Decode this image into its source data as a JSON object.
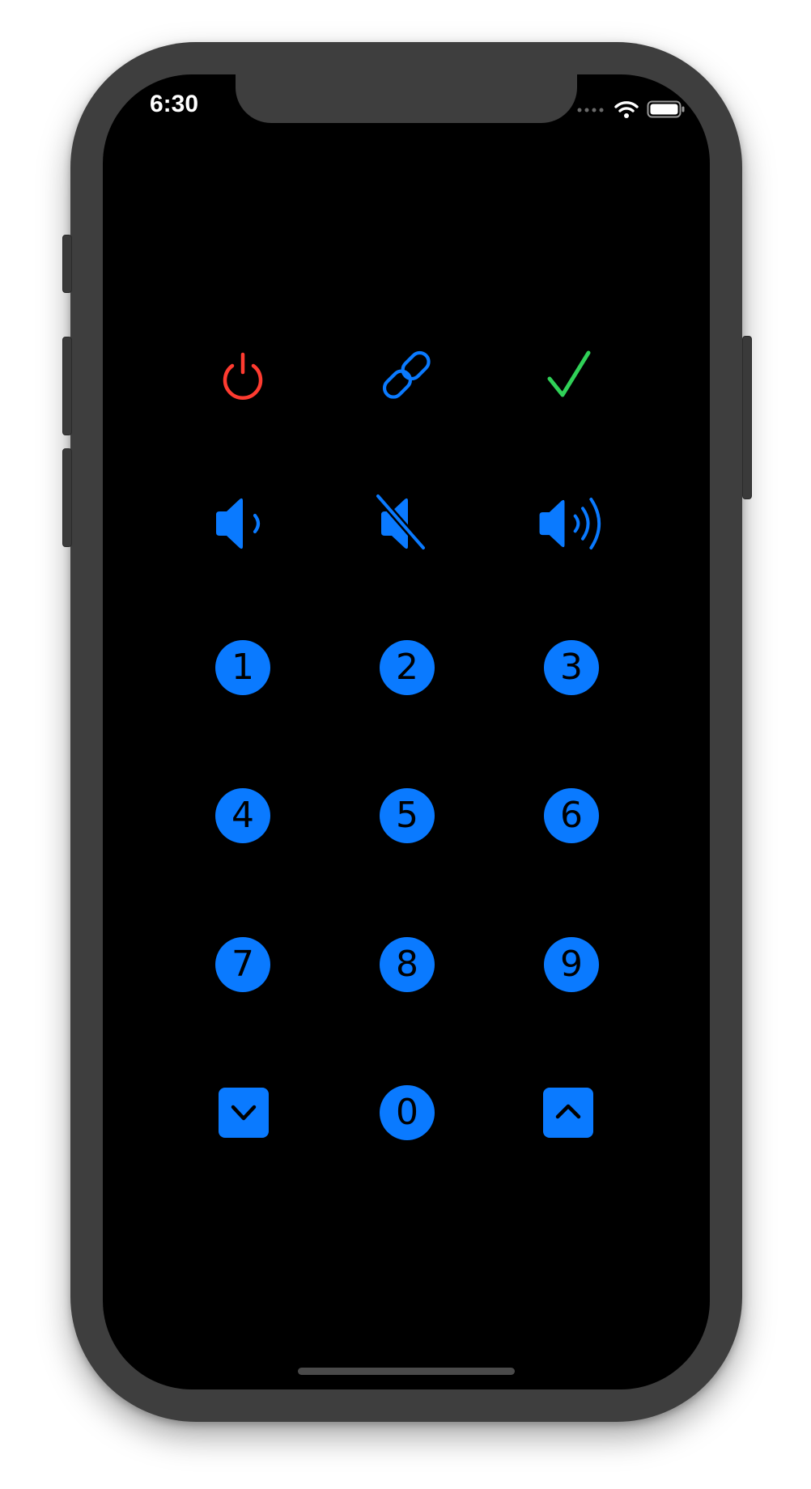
{
  "status_bar": {
    "time": "6:30",
    "icons": [
      "signal-dots-icon",
      "wifi-icon",
      "battery-icon"
    ]
  },
  "colors": {
    "accent": "#0a7aff",
    "power": "#ff3b30",
    "check": "#30d158",
    "background": "#000000",
    "device_frame": "#3e3e3e"
  },
  "controls": {
    "row1": [
      "power-icon",
      "link-icon",
      "checkmark-icon"
    ],
    "row2": [
      "speaker-low-icon",
      "speaker-muted-icon",
      "speaker-high-icon"
    ]
  },
  "keypad": {
    "k1": "1",
    "k2": "2",
    "k3": "3",
    "k4": "4",
    "k5": "5",
    "k6": "6",
    "k7": "7",
    "k8": "8",
    "k9": "9",
    "k0": "0",
    "down_icon": "chevron-down-icon",
    "up_icon": "chevron-up-icon"
  }
}
